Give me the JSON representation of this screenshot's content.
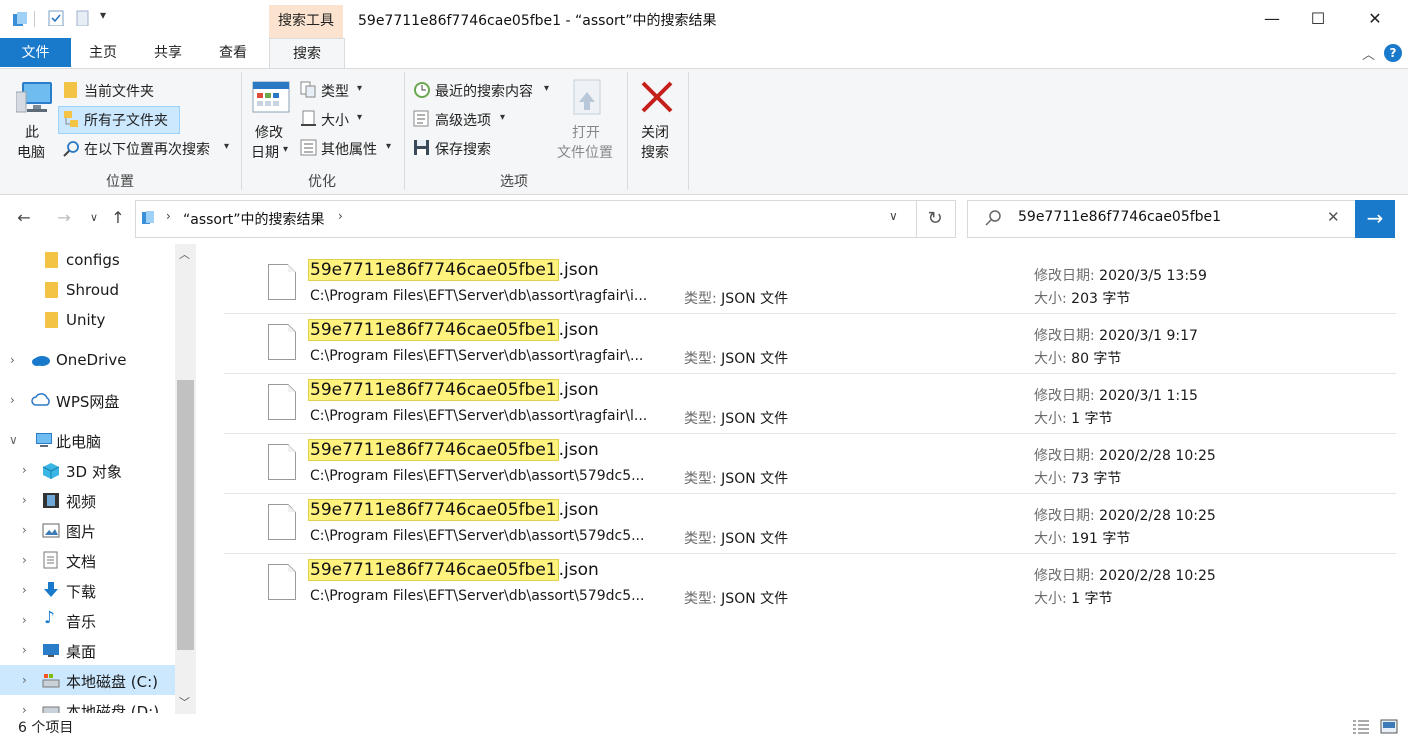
{
  "window": {
    "context_tab": "搜索工具",
    "title": "59e7711e86f7746cae05fbe1 - “assort”中的搜索结果",
    "minimize": "—",
    "maximize": "☐",
    "close": "✕"
  },
  "tabs": [
    "文件",
    "主页",
    "共享",
    "查看",
    "搜索"
  ],
  "ribbon": {
    "location": {
      "this_pc_line1": "此",
      "this_pc_line2": "电脑",
      "current_folder": "当前文件夹",
      "all_subfolders": "所有子文件夹",
      "search_again_in": "在以下位置再次搜索",
      "group": "位置"
    },
    "refine": {
      "date_modified_line1": "修改",
      "date_modified_line2": "日期",
      "kind": "类型",
      "size": "大小",
      "other_properties": "其他属性",
      "group": "优化"
    },
    "options": {
      "recent_searches": "最近的搜索内容",
      "advanced_options": "高级选项",
      "save_search": "保存搜索",
      "open_location_line1": "打开",
      "open_location_line2": "文件位置",
      "group": "选项"
    },
    "close": {
      "line1": "关闭",
      "line2": "搜索"
    }
  },
  "address": {
    "path": "“assort”中的搜索结果",
    "search_text": "59e7711e86f7746cae05fbe1"
  },
  "nav": [
    {
      "label": "configs"
    },
    {
      "label": "Shroud"
    },
    {
      "label": "Unity"
    },
    {
      "label": "OneDrive"
    },
    {
      "label": "WPS网盘"
    },
    {
      "label": "此电脑"
    },
    {
      "label": "3D 对象"
    },
    {
      "label": "视频"
    },
    {
      "label": "图片"
    },
    {
      "label": "文档"
    },
    {
      "label": "下载"
    },
    {
      "label": "音乐"
    },
    {
      "label": "桌面"
    },
    {
      "label": "本地磁盘 (C:)"
    },
    {
      "label": "本地磁盘 (D:)"
    }
  ],
  "results_meta": {
    "type_key": "类型:",
    "date_key": "修改日期:",
    "size_key": "大小:"
  },
  "results": [
    {
      "match": "59e7711e86f7746cae05fbe1",
      "ext": ".json",
      "path": "C:\\Program Files\\EFT\\Server\\db\\assort\\ragfair\\i...",
      "type": "JSON 文件",
      "date": "2020/3/5 13:59",
      "size": "203 字节"
    },
    {
      "match": "59e7711e86f7746cae05fbe1",
      "ext": ".json",
      "path": "C:\\Program Files\\EFT\\Server\\db\\assort\\ragfair\\...",
      "type": "JSON 文件",
      "date": "2020/3/1 9:17",
      "size": "80 字节"
    },
    {
      "match": "59e7711e86f7746cae05fbe1",
      "ext": ".json",
      "path": "C:\\Program Files\\EFT\\Server\\db\\assort\\ragfair\\l...",
      "type": "JSON 文件",
      "date": "2020/3/1 1:15",
      "size": "1 字节"
    },
    {
      "match": "59e7711e86f7746cae05fbe1",
      "ext": ".json",
      "path": "C:\\Program Files\\EFT\\Server\\db\\assort\\579dc5...",
      "type": "JSON 文件",
      "date": "2020/2/28 10:25",
      "size": "73 字节"
    },
    {
      "match": "59e7711e86f7746cae05fbe1",
      "ext": ".json",
      "path": "C:\\Program Files\\EFT\\Server\\db\\assort\\579dc5...",
      "type": "JSON 文件",
      "date": "2020/2/28 10:25",
      "size": "191 字节"
    },
    {
      "match": "59e7711e86f7746cae05fbe1",
      "ext": ".json",
      "path": "C:\\Program Files\\EFT\\Server\\db\\assort\\579dc5...",
      "type": "JSON 文件",
      "date": "2020/2/28 10:25",
      "size": "1 字节"
    }
  ],
  "status": {
    "count": "6 个项目"
  },
  "colors": {
    "accent": "#1979ca",
    "context_tab": "#fbe3cf",
    "highlight": "#fff37e",
    "selected": "#cce8ff"
  }
}
